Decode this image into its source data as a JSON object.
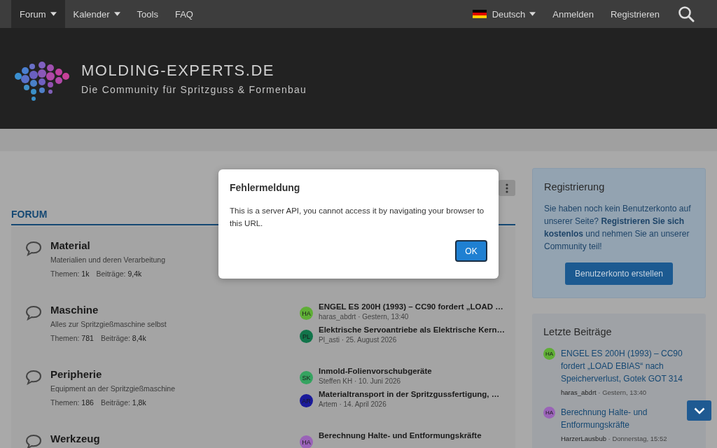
{
  "nav": {
    "items": [
      {
        "label": "Forum",
        "dropdown": true,
        "selected": true
      },
      {
        "label": "Kalender",
        "dropdown": true,
        "selected": false
      },
      {
        "label": "Tools",
        "dropdown": false,
        "selected": false
      },
      {
        "label": "FAQ",
        "dropdown": false,
        "selected": false
      }
    ],
    "language": "Deutsch",
    "links": [
      "Anmelden",
      "Registrieren"
    ]
  },
  "header": {
    "title": "MOLDING-EXPERTS.DE",
    "tagline": "Die Community für Spritzguss & Formenbau"
  },
  "forum": {
    "heading": "FORUM",
    "nodes": [
      {
        "title": "Material",
        "description": "Materialien und deren Verarbeitung",
        "stats": [
          {
            "label": "Themen:",
            "value": "1k"
          },
          {
            "label": "Beiträge:",
            "value": "9,4k"
          }
        ]
      },
      {
        "title": "Maschine",
        "description": "Alles zur Spritzgießmaschine selbst",
        "stats": [
          {
            "label": "Themen:",
            "value": "781"
          },
          {
            "label": "Beiträge:",
            "value": "8,4k"
          }
        ],
        "posts": [
          {
            "initials": "HA",
            "color": "#5fae36",
            "title": "ENGEL ES 200H (1993) – CC90 fordert „LOAD …",
            "author": "haras_abdrt",
            "time": "· Gestern, 13:40"
          },
          {
            "initials": "PL",
            "color": "#11744a",
            "title": "Elektrische Servoantriebe als Elektrische Kern…",
            "author": "Pl_asti",
            "time": "· 25. August 2026"
          }
        ]
      },
      {
        "title": "Peripherie",
        "description": "Equipment an der Spritzgießmaschine",
        "stats": [
          {
            "label": "Themen:",
            "value": "186"
          },
          {
            "label": "Beiträge:",
            "value": "1,8k"
          }
        ],
        "posts": [
          {
            "initials": "SK",
            "color": "#35a360",
            "title": "Inmold-Folienvorschubgeräte",
            "author": "Steffen KH",
            "time": "· 10. Juni 2026"
          },
          {
            "initials": "AR",
            "color": "#1a1a9a",
            "title": "Materialtransport in der Spritzgussfertigung, …",
            "author": "Artem",
            "time": "· 14. April 2026"
          }
        ]
      },
      {
        "title": "Werkzeug",
        "posts": [
          {
            "initials": "HA",
            "color": "#9a63b8",
            "title": "Berechnung Halte- und Entformungskräfte"
          }
        ]
      }
    ]
  },
  "sidebar": {
    "registration": {
      "title": "Registrierung",
      "text": "Sie haben noch kein Benutzerkonto auf unserer Seite? **Registrieren Sie sich kostenlos** und nehmen Sie an unserer Community teil!",
      "button": "Benutzerkonto erstellen"
    },
    "latest": {
      "title": "Letzte Beiträge",
      "posts": [
        {
          "initials": "HA",
          "color": "#5fae36",
          "title": "ENGEL ES 200H (1993) – CC90 fordert „LOAD EBIAS“ nach Speicherverlust, Gotek GOT 314",
          "author": "haras_abdrt",
          "time": "· Gestern, 13:40"
        },
        {
          "initials": "HA",
          "color": "#9a63b8",
          "title": "Berechnung Halte- und Entformungskräfte",
          "author": "HarzerLausbub",
          "time": "· Donnerstag, 15:52"
        }
      ]
    }
  },
  "dialog": {
    "title": "Fehlermeldung",
    "message": "This is a server API, you cannot access it by navigating your browser to this URL.",
    "button": "OK"
  }
}
